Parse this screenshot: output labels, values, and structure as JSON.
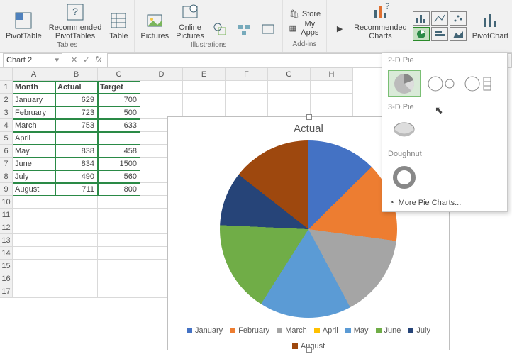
{
  "ribbon": {
    "groups": {
      "tables": {
        "label": "Tables",
        "pivotTable": "PivotTable",
        "recommended": "Recommended\nPivotTables",
        "table": "Table"
      },
      "illustrations": {
        "label": "Illustrations",
        "pictures": "Pictures",
        "online": "Online\nPictures"
      },
      "addins": {
        "label": "Add-ins",
        "store": "Store",
        "myapps": "My Apps"
      },
      "charts": {
        "recommended": "Recommended\nCharts",
        "pivotChart": "PivotChart"
      }
    }
  },
  "namebox": {
    "value": "Chart 2"
  },
  "columns": [
    "A",
    "B",
    "C",
    "D",
    "E",
    "F",
    "G",
    "H"
  ],
  "rows": [
    "1",
    "2",
    "3",
    "4",
    "5",
    "6",
    "7",
    "8",
    "9",
    "10",
    "11",
    "12",
    "13",
    "14",
    "15",
    "16",
    "17"
  ],
  "table": {
    "headers": [
      "Month",
      "Actual",
      "Target"
    ],
    "rows": [
      {
        "m": "January",
        "a": 629,
        "t": 700
      },
      {
        "m": "February",
        "a": 723,
        "t": 500
      },
      {
        "m": "March",
        "a": 753,
        "t": 633
      },
      {
        "m": "April",
        "a": "",
        "t": ""
      },
      {
        "m": "May",
        "a": 838,
        "t": 458
      },
      {
        "m": "June",
        "a": 834,
        "t": 1500
      },
      {
        "m": "July",
        "a": 490,
        "t": 560
      },
      {
        "m": "August",
        "a": 711,
        "t": 800
      }
    ]
  },
  "chart": {
    "title": "Actual",
    "legend": [
      "January",
      "February",
      "March",
      "April",
      "May",
      "June",
      "July",
      "August"
    ],
    "colors": [
      "#4472c4",
      "#ed7d31",
      "#a5a5a5",
      "#ffc000",
      "#5b9bd5",
      "#70ad47",
      "#264478",
      "#9e480e"
    ]
  },
  "dropdown": {
    "sec1": "2-D Pie",
    "sec2": "3-D Pie",
    "sec3": "Doughnut",
    "more": "More Pie Charts..."
  },
  "chart_data": {
    "type": "pie",
    "title": "Actual",
    "categories": [
      "January",
      "February",
      "March",
      "April",
      "May",
      "June",
      "July",
      "August"
    ],
    "values": [
      629,
      723,
      753,
      0,
      838,
      834,
      490,
      711
    ],
    "colors": [
      "#4472c4",
      "#ed7d31",
      "#a5a5a5",
      "#ffc000",
      "#5b9bd5",
      "#70ad47",
      "#264478",
      "#9e480e"
    ]
  }
}
